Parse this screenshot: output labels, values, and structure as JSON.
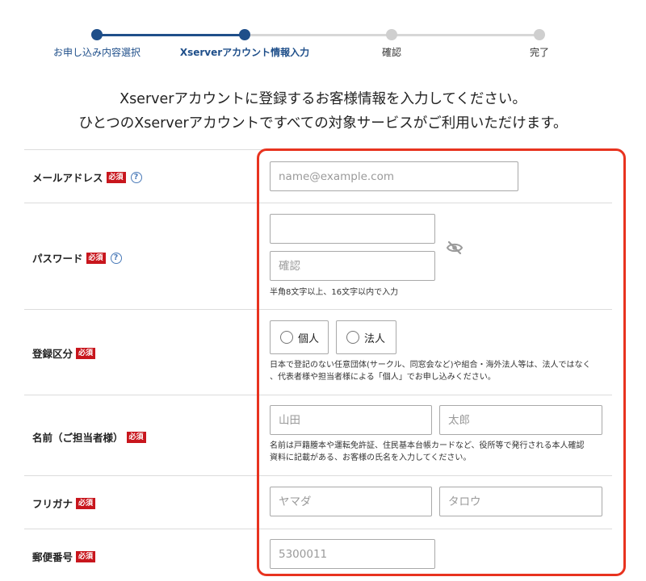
{
  "stepper": {
    "steps": [
      {
        "label": "お申し込み内容選択"
      },
      {
        "label": "Xserverアカウント情報入力"
      },
      {
        "label": "確認"
      },
      {
        "label": "完了"
      }
    ]
  },
  "intro": {
    "line1": "Xserverアカウントに登録するお客様情報を入力してください。",
    "line2": "ひとつのXserverアカウントですべての対象サービスがご利用いただけます。"
  },
  "form": {
    "required_badge": "必須",
    "help_icon_glyph": "?",
    "email": {
      "label": "メールアドレス",
      "placeholder": "name@example.com",
      "value": ""
    },
    "password": {
      "label": "パスワード",
      "placeholder": "",
      "confirm_placeholder": "確認",
      "note": "半角8文字以上、16文字以内で入力"
    },
    "registration_type": {
      "label": "登録区分",
      "options": [
        "個人",
        "法人"
      ],
      "note_line1": "日本で登記のない任意団体(サークル、同窓会など)や組合・海外法人等は、法人ではなく",
      "note_line2": "、代表者様や担当者様による「個人」でお申し込みください。"
    },
    "name": {
      "label": "名前（ご担当者様）",
      "last_placeholder": "山田",
      "first_placeholder": "太郎",
      "note_line1": "名前は戸籍謄本や運転免許証、住民基本台帳カードなど、役所等で発行される本人確認",
      "note_line2": "資料に記載がある、お客様の氏名を入力してください。"
    },
    "furigana": {
      "label": "フリガナ",
      "last_placeholder": "ヤマダ",
      "first_placeholder": "タロウ"
    },
    "postal_code": {
      "label": "郵便番号",
      "placeholder": "5300011"
    }
  },
  "colors": {
    "accent": "#1f4f8a",
    "required": "#c8161d",
    "highlight": "#e8331f",
    "inactive_step": "#cfcfcf"
  }
}
